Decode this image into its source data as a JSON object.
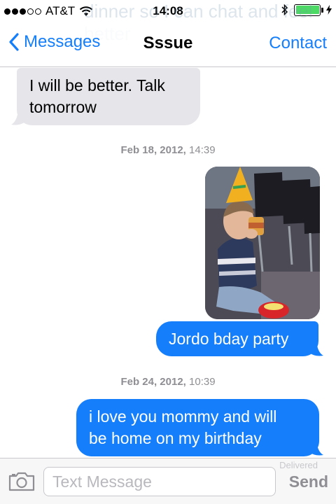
{
  "status_bar": {
    "carrier": "AT&T",
    "time": "14:08",
    "signal_bars_filled": 3,
    "signal_bars_total": 5,
    "battery_level": 1.0,
    "battery_color": "#4cd964"
  },
  "ghost_text": "dinner so I can chat and feel better",
  "nav": {
    "back_label": "Messages",
    "title": "Sssue",
    "action_label": "Contact"
  },
  "messages": [
    {
      "direction": "incoming",
      "text_line1": "I will be better. Talk",
      "text_line2": "tomorrow"
    },
    {
      "direction": "outgoing",
      "text": "Jordo bday party"
    },
    {
      "direction": "outgoing",
      "text_line1": "i love you mommy and will",
      "text_line2": "be home on my birthday"
    }
  ],
  "timestamps": [
    {
      "date": "Feb 18, 2012,",
      "time": "14:39"
    },
    {
      "date": "Feb 24, 2012,",
      "time": "10:39"
    }
  ],
  "delivered_label": "Delivered",
  "input_bar": {
    "placeholder": "Text Message",
    "send_label": "Send"
  },
  "colors": {
    "accent": "#157efb",
    "incoming_bubble": "#e5e5ea",
    "outgoing_bubble": "#157efb"
  },
  "icons": {
    "back": "chevron-left-icon",
    "camera": "camera-icon",
    "wifi": "wifi-icon",
    "bluetooth": "bluetooth-icon",
    "charging": "bolt-icon"
  }
}
